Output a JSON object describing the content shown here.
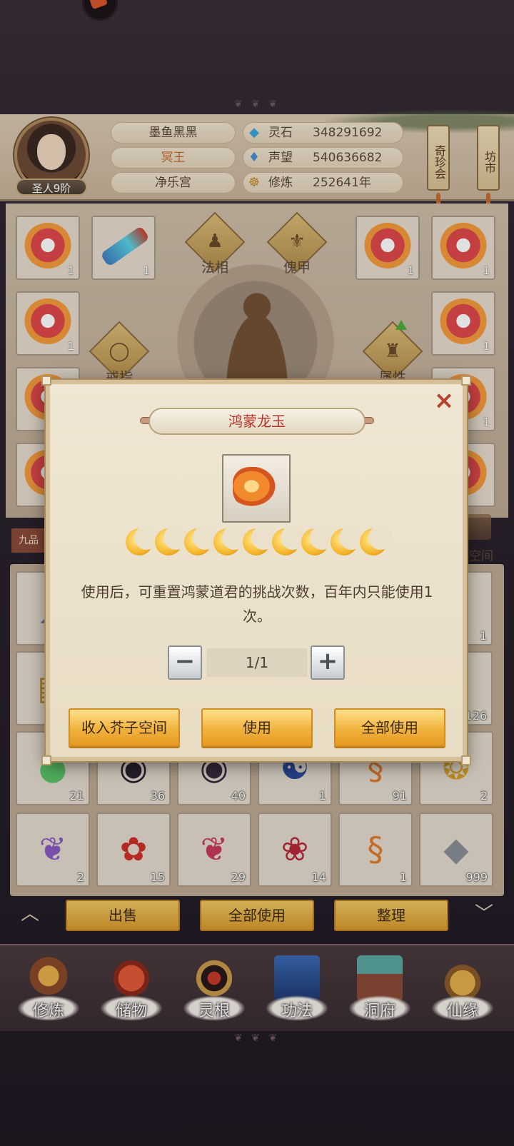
{
  "player": {
    "rank": "圣人9阶",
    "name": "墨鱼黑黑",
    "title": "冥王",
    "sect": "净乐宫"
  },
  "resources": [
    {
      "icon": "spirit-stone-icon",
      "label": "灵石",
      "value": "348291692"
    },
    {
      "icon": "prestige-icon",
      "label": "声望",
      "value": "540636682"
    },
    {
      "icon": "cultivation-icon",
      "label": "修炼",
      "value": "252641年"
    }
  ],
  "hanging_signs": {
    "treasure_fair": "奇珍会",
    "market": "坊市"
  },
  "equipment": {
    "labels": {
      "dharma_form": "法相",
      "puppet_armor": "傀甲",
      "ring": "戒指",
      "attribute": "属性"
    },
    "slot_counts": [
      "1",
      "1",
      "1",
      "1",
      "1",
      "1",
      "1"
    ]
  },
  "inventory": {
    "tab_label": "九品",
    "storage_label": "子空间",
    "row1_counts": [
      "1"
    ],
    "row2_counts": [
      "126"
    ],
    "row3_counts": [
      "21",
      "36",
      "40",
      "1",
      "91",
      "2"
    ],
    "row4_counts": [
      "2",
      "15",
      "29",
      "14",
      "1",
      "999"
    ]
  },
  "bottom_actions": {
    "sell": "出售",
    "use_all": "全部使用",
    "sort": "整理"
  },
  "nav": [
    {
      "label": "修炼",
      "icon": "cultivate-icon"
    },
    {
      "label": "储物",
      "icon": "storage-bag-icon"
    },
    {
      "label": "灵根",
      "icon": "spirit-root-icon"
    },
    {
      "label": "功法",
      "icon": "technique-book-icon"
    },
    {
      "label": "洞府",
      "icon": "cave-house-icon"
    },
    {
      "label": "仙缘",
      "icon": "gourd-icon"
    }
  ],
  "modal": {
    "title": "鸿蒙龙玉",
    "star_count": 9,
    "description": "使用后，可重置鸿蒙道君的挑战次数，百年内只能使用1次。",
    "quantity": "1/1",
    "minus_label": "−",
    "plus_label": "+",
    "close_label": "×",
    "buttons": {
      "store": "收入芥子空间",
      "use": "使用",
      "use_all": "全部使用"
    }
  },
  "colors": {
    "title_red": "#b8332a",
    "button_gold": "#f0b23e",
    "panel_bg": "#efe6d3"
  }
}
